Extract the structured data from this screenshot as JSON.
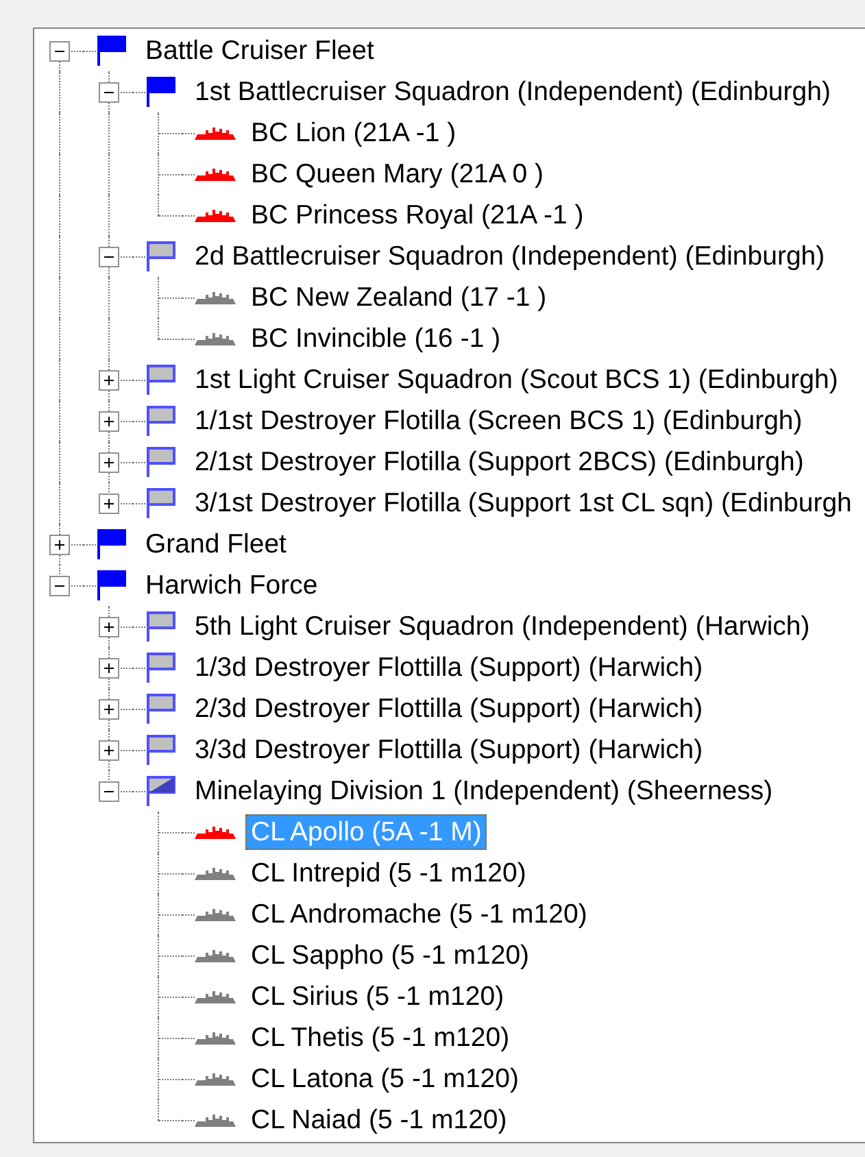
{
  "tree": [
    {
      "kind": "flag_full",
      "label": "Battle Cruiser Fleet",
      "expanded": true,
      "selected": false,
      "children": [
        {
          "kind": "flag_full",
          "label": "1st Battlecruiser Squadron (Independent) (Edinburgh)",
          "expanded": true,
          "selected": false,
          "children": [
            {
              "kind": "ship",
              "color": "#ff0000",
              "label": "BC Lion (21A -1 )",
              "selected": false
            },
            {
              "kind": "ship",
              "color": "#ff0000",
              "label": "BC Queen Mary (21A 0 )",
              "selected": false
            },
            {
              "kind": "ship",
              "color": "#ff0000",
              "label": "BC Princess Royal (21A -1 )",
              "selected": false
            }
          ]
        },
        {
          "kind": "flag_empty",
          "label": "2d Battlecruiser Squadron (Independent) (Edinburgh)",
          "expanded": true,
          "selected": false,
          "children": [
            {
              "kind": "ship",
              "color": "#808080",
              "label": "BC New Zealand (17 -1 )",
              "selected": false
            },
            {
              "kind": "ship",
              "color": "#808080",
              "label": "BC Invincible (16 -1 )",
              "selected": false
            }
          ]
        },
        {
          "kind": "flag_empty",
          "label": "1st Light Cruiser Squadron (Scout BCS 1) (Edinburgh)",
          "expanded": false,
          "selected": false
        },
        {
          "kind": "flag_empty",
          "label": "1/1st Destroyer Flotilla (Screen BCS 1) (Edinburgh)",
          "expanded": false,
          "selected": false
        },
        {
          "kind": "flag_empty",
          "label": "2/1st Destroyer Flotilla (Support 2BCS) (Edinburgh)",
          "expanded": false,
          "selected": false
        },
        {
          "kind": "flag_empty",
          "label": "3/1st Destroyer Flotilla (Support 1st CL sqn) (Edinburgh",
          "expanded": false,
          "selected": false
        }
      ]
    },
    {
      "kind": "flag_full",
      "label": "Grand Fleet",
      "expanded": false,
      "selected": false
    },
    {
      "kind": "flag_full",
      "label": "Harwich Force",
      "expanded": true,
      "selected": false,
      "children": [
        {
          "kind": "flag_empty",
          "label": "5th Light Cruiser Squadron (Independent) (Harwich)",
          "expanded": false,
          "selected": false
        },
        {
          "kind": "flag_empty",
          "label": "1/3d Destroyer Flottilla (Support) (Harwich)",
          "expanded": false,
          "selected": false
        },
        {
          "kind": "flag_empty",
          "label": "2/3d Destroyer Flottilla (Support) (Harwich)",
          "expanded": false,
          "selected": false
        },
        {
          "kind": "flag_empty",
          "label": "3/3d Destroyer Flottilla (Support) (Harwich)",
          "expanded": false,
          "selected": false
        },
        {
          "kind": "flag_half",
          "label": "Minelaying Division 1 (Independent) (Sheerness)",
          "expanded": true,
          "selected": false,
          "children": [
            {
              "kind": "ship",
              "color": "#ff0000",
              "label": "CL Apollo (5A -1 M)",
              "selected": true
            },
            {
              "kind": "ship",
              "color": "#808080",
              "label": "CL Intrepid (5 -1 m120)",
              "selected": false
            },
            {
              "kind": "ship",
              "color": "#808080",
              "label": "CL Andromache (5 -1 m120)",
              "selected": false
            },
            {
              "kind": "ship",
              "color": "#808080",
              "label": "CL Sappho (5 -1 m120)",
              "selected": false
            },
            {
              "kind": "ship",
              "color": "#808080",
              "label": "CL Sirius (5 -1 m120)",
              "selected": false
            },
            {
              "kind": "ship",
              "color": "#808080",
              "label": "CL Thetis (5 -1 m120)",
              "selected": false
            },
            {
              "kind": "ship",
              "color": "#808080",
              "label": "CL Latona (5 -1 m120)",
              "selected": false
            },
            {
              "kind": "ship",
              "color": "#808080",
              "label": "CL Naiad (5 -1 m120)",
              "selected": false
            }
          ]
        }
      ]
    }
  ]
}
